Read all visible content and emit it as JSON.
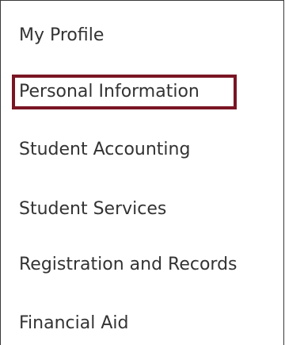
{
  "menu": {
    "items": [
      {
        "label": "My Profile"
      },
      {
        "label": "Personal Information",
        "highlighted": true
      },
      {
        "label": "Student Accounting"
      },
      {
        "label": "Student Services"
      },
      {
        "label": "Registration and Records"
      },
      {
        "label": "Financial Aid"
      }
    ]
  },
  "colors": {
    "highlight_border": "#7a1523",
    "text": "#333333",
    "panel_border": "#3a3a3a",
    "background": "#ffffff"
  }
}
